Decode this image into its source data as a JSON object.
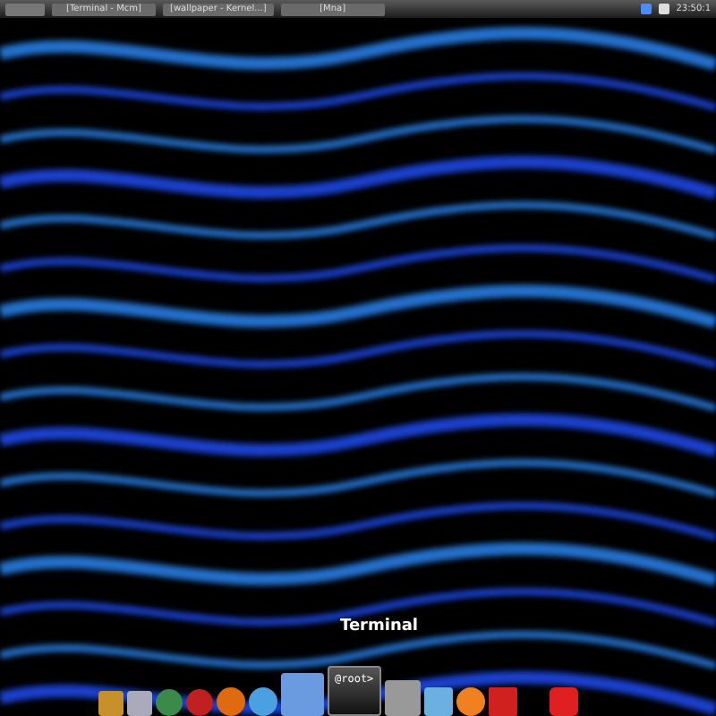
{
  "top_panel": {
    "tasks": [
      {
        "label": "[Terminal - Mcm]",
        "selected": false
      },
      {
        "label": "[wallpaper - Kernel...]",
        "selected": false
      },
      {
        "label": "[Mna]",
        "selected": false
      }
    ],
    "clock": "23:50:1"
  },
  "dock": {
    "tooltip": "Terminal",
    "terminal_prompt": "@root>"
  }
}
